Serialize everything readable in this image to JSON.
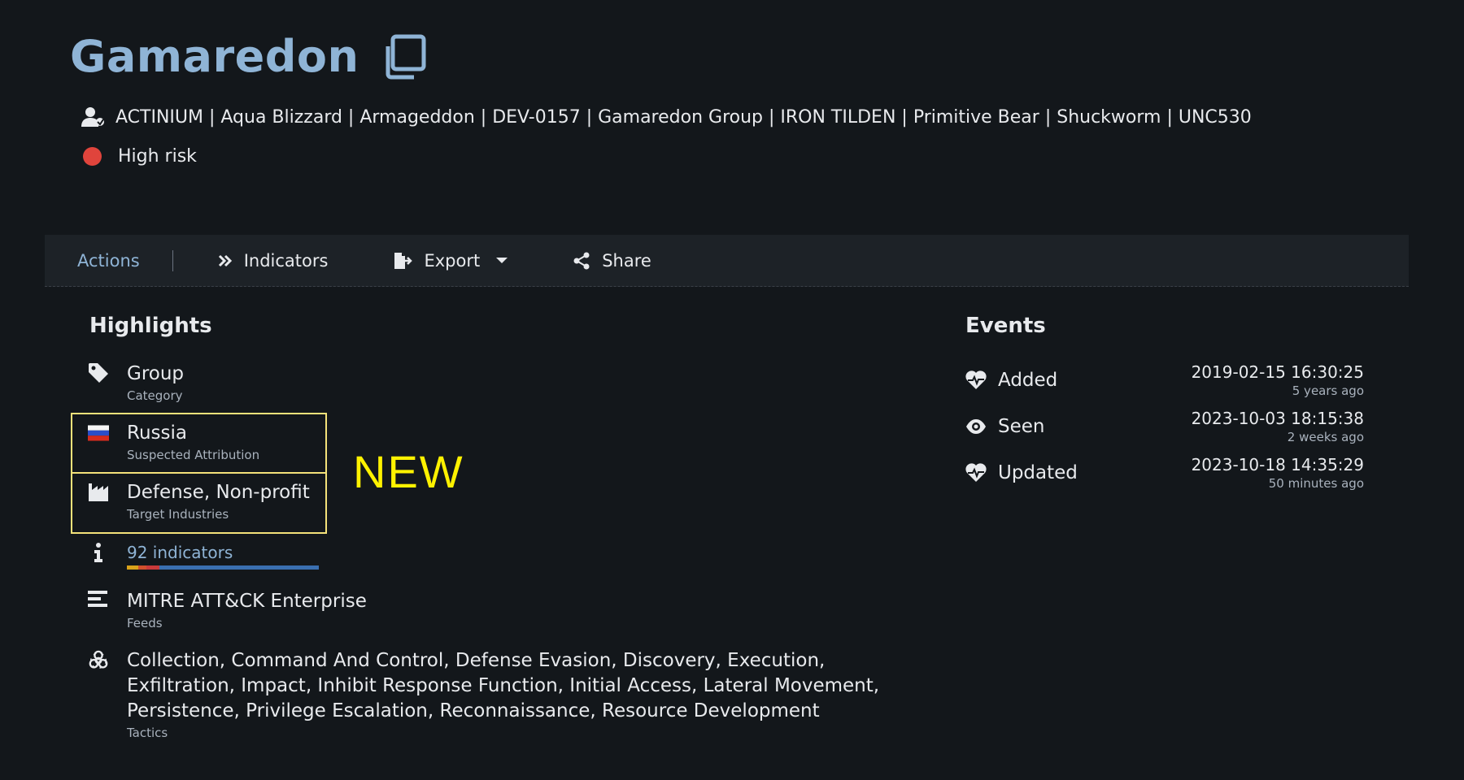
{
  "header": {
    "title": "Gamaredon",
    "aliases": "ACTINIUM | Aqua Blizzard | Armageddon | DEV-0157 | Gamaredon Group | IRON TILDEN | Primitive Bear | Shuckworm | UNC530",
    "risk": "High risk"
  },
  "toolbar": {
    "actions": "Actions",
    "indicators": "Indicators",
    "export": "Export",
    "share": "Share"
  },
  "highlights": {
    "title": "Highlights",
    "category": {
      "value": "Group",
      "label": "Category"
    },
    "attribution": {
      "value": "Russia",
      "label": "Suspected Attribution"
    },
    "industries": {
      "value": "Defense, Non-profit",
      "label": "Target Industries"
    },
    "indicators": {
      "value": "92 indicators",
      "bar_segments": [
        {
          "fraction": 0.06,
          "color": "#d9a21a"
        },
        {
          "fraction": 0.04,
          "color": "#d1502d"
        },
        {
          "fraction": 0.07,
          "color": "#c93a3a"
        },
        {
          "fraction": 0.83,
          "color": "#3a6fb0"
        }
      ]
    },
    "feeds": {
      "value": "MITRE ATT&CK Enterprise",
      "label": "Feeds"
    },
    "tactics": {
      "line1": "Collection, Command And Control, Defense Evasion, Discovery, Execution,",
      "line2": "Exfiltration, Impact, Inhibit Response Function, Initial Access, Lateral Movement,",
      "line3": "Persistence, Privilege Escalation, Reconnaissance, Resource Development",
      "label": "Tactics"
    }
  },
  "annotation": {
    "new": "NEW",
    "color": "#fff200"
  },
  "events": {
    "title": "Events",
    "items": [
      {
        "label": "Added",
        "date": "2019-02-15 16:30:25",
        "relative": "5 years ago",
        "icon": "heartbeat-icon"
      },
      {
        "label": "Seen",
        "date": "2023-10-03 18:15:38",
        "relative": "2 weeks ago",
        "icon": "eye-icon"
      },
      {
        "label": "Updated",
        "date": "2023-10-18 14:35:29",
        "relative": "50 minutes ago",
        "icon": "heartbeat-icon"
      }
    ]
  },
  "colors": {
    "background": "#13171b",
    "accent": "#8fb4d6",
    "risk": "#e0443c",
    "highlight_box": "#f4e27a"
  }
}
